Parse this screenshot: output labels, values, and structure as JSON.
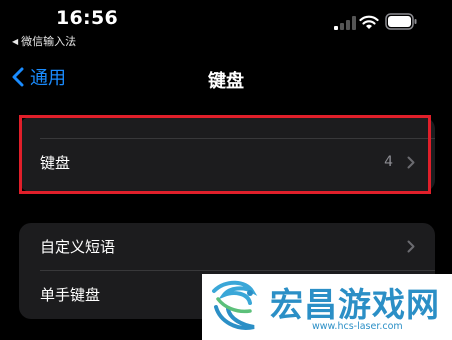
{
  "status_bar": {
    "time": "16:56",
    "back_app": "微信输入法"
  },
  "nav": {
    "back_label": "通用",
    "title": "键盘"
  },
  "group1": {
    "rows": [
      {
        "label": "键盘",
        "value": "4"
      }
    ]
  },
  "group2": {
    "rows": [
      {
        "label": "自定义短语"
      },
      {
        "label": "单手键盘"
      }
    ]
  },
  "watermark": {
    "title": "宏昌游戏网",
    "url": "www.hcs-laser.com"
  },
  "colors": {
    "accent": "#1a8cff",
    "highlight": "#e01f2a",
    "watermark": "#2b8fc6"
  }
}
